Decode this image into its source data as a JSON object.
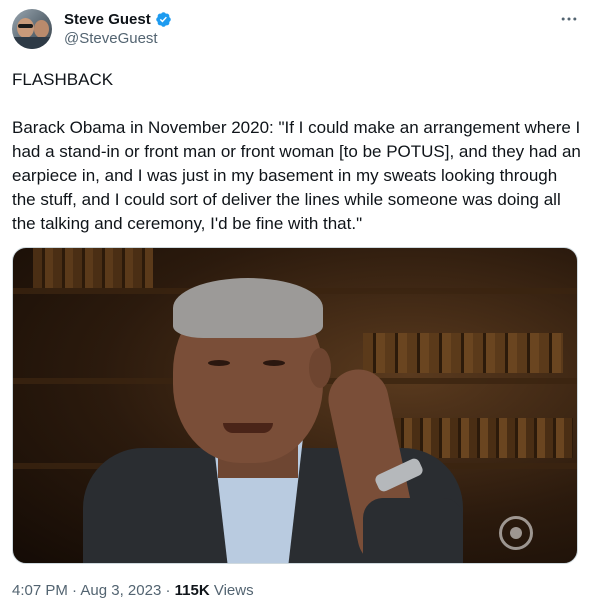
{
  "author": {
    "name": "Steve Guest",
    "handle": "@SteveGuest",
    "verified_color": "#1d9bf0"
  },
  "menu_icon": "more-horizontal-icon",
  "tweet": {
    "text": "FLASHBACK\n\nBarack Obama in November 2020: \"If I could make an arrangement where I had a stand-in or front man or front woman [to be POTUS], and they had an earpiece in, and I was just in my basement in my sweats looking through the stuff, and I could sort of deliver the lines while someone was doing all the talking and ceremony, I'd be fine with that.\""
  },
  "meta": {
    "time": "4:07 PM",
    "separator": "·",
    "date": "Aug 3, 2023",
    "views_count": "115K",
    "views_label": "Views"
  }
}
